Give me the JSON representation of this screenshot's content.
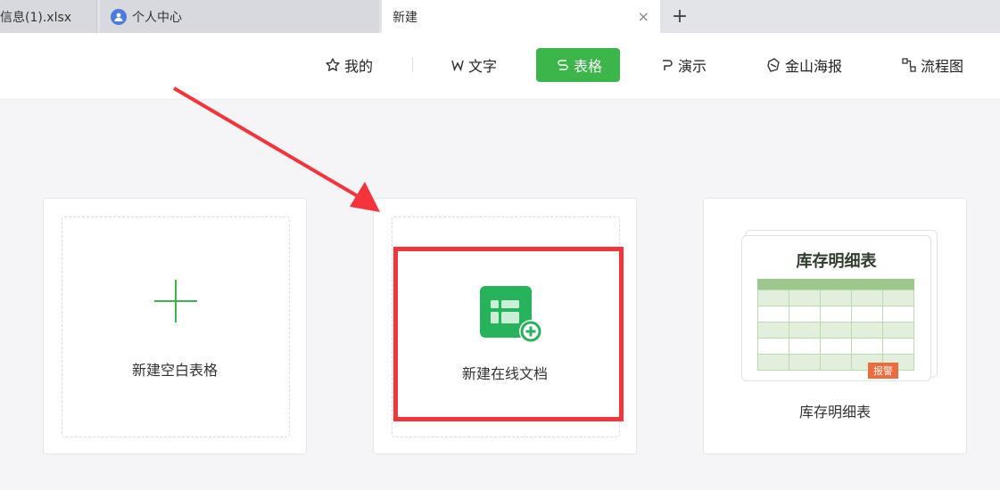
{
  "tabs": [
    {
      "label": "信息(1).xlsx"
    },
    {
      "label": "个人中心"
    },
    {
      "label": "新建",
      "close": "×"
    }
  ],
  "new_tab": "+",
  "nav": {
    "items": [
      {
        "label": "我的",
        "icon": "star-icon"
      },
      {
        "label": "文字",
        "icon": "w-icon"
      },
      {
        "label": "表格",
        "icon": "s-icon",
        "active": true
      },
      {
        "label": "演示",
        "icon": "p-icon"
      },
      {
        "label": "金山海报",
        "icon": "poster-icon"
      },
      {
        "label": "流程图",
        "icon": "flowchart-icon"
      }
    ]
  },
  "cards": [
    {
      "label": "新建空白表格",
      "icon": "plus-icon"
    },
    {
      "label": "新建在线文档",
      "icon": "online-sheet-icon"
    },
    {
      "label": "库存明细表",
      "thumbnail_title": "库存明细表",
      "badge": "报警"
    }
  ],
  "colors": {
    "accent": "#3cb54a",
    "highlight": "#f5333a",
    "badge": "#ee6b3b"
  }
}
